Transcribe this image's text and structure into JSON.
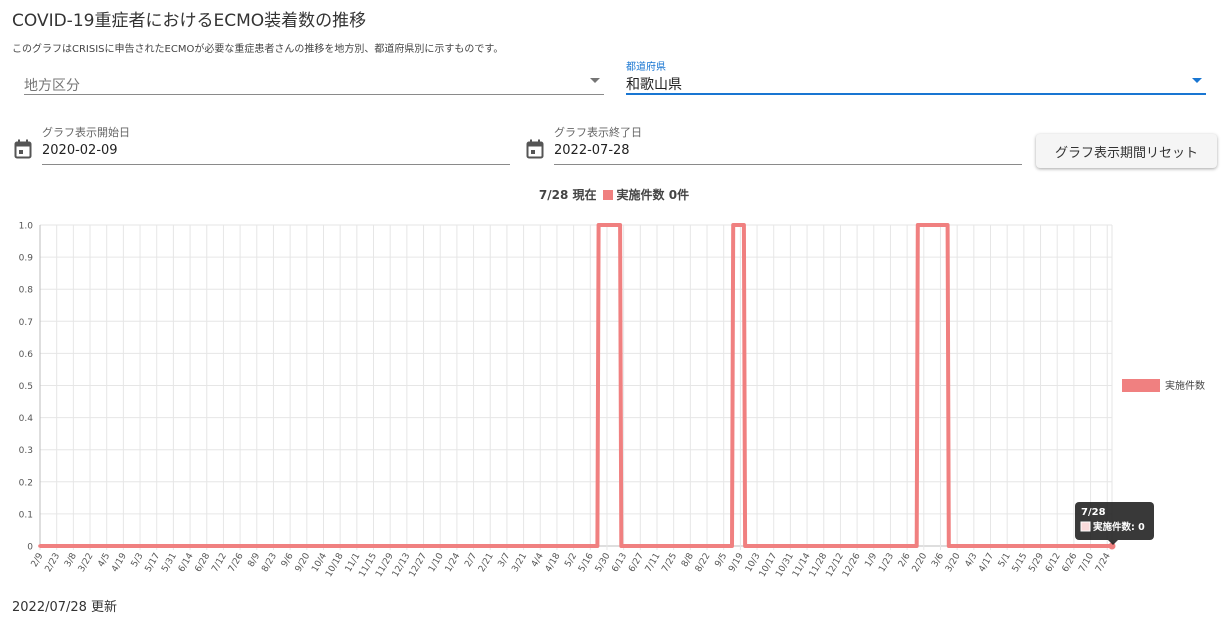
{
  "header": {
    "title": "COVID-19重症者におけるECMO装着数の推移",
    "description": "このグラフはCRISISに申告されたECMOが必要な重症患者さんの推移を地方別、都道府県別に示すものです。"
  },
  "filters": {
    "region": {
      "placeholder": "地方区分",
      "value": ""
    },
    "prefecture": {
      "label": "都道府県",
      "value": "和歌山県"
    }
  },
  "date_range": {
    "start": {
      "label": "グラフ表示開始日",
      "value": "2020-02-09"
    },
    "end": {
      "label": "グラフ表示終了日",
      "value": "2022-07-28"
    },
    "reset_label": "グラフ表示期間リセット"
  },
  "summary": {
    "date": "7/28 現在",
    "series_label": "実施件数",
    "count": "0件"
  },
  "tooltip": {
    "title": "7/28",
    "label": "実施件数: 0"
  },
  "footer": {
    "updated": "2022/07/28 更新"
  },
  "colors": {
    "series": "#f08080",
    "accent": "#1976d2"
  },
  "chart_data": {
    "type": "line",
    "title": "",
    "xlabel": "",
    "ylabel": "",
    "ylim": [
      0,
      1
    ],
    "yticks": [
      0,
      0.1,
      0.2,
      0.3,
      0.4,
      0.5,
      0.6,
      0.7,
      0.8,
      0.9,
      1.0
    ],
    "ytick_labels": [
      "0",
      "0.1",
      "0.2",
      "0.3",
      "0.4",
      "0.5",
      "0.6",
      "0.7",
      "0.8",
      "0.9",
      "1.0"
    ],
    "x_start": "2020-02-09",
    "x_end": "2022-07-28",
    "xtick_labels": [
      "2/9",
      "2/23",
      "3/8",
      "3/22",
      "4/5",
      "4/19",
      "5/3",
      "5/17",
      "5/31",
      "6/14",
      "6/28",
      "7/12",
      "7/26",
      "8/9",
      "8/23",
      "9/6",
      "9/20",
      "10/4",
      "10/18",
      "11/1",
      "11/15",
      "11/29",
      "12/13",
      "12/27",
      "1/10",
      "1/24",
      "2/7",
      "2/21",
      "3/7",
      "3/21",
      "4/4",
      "4/18",
      "5/2",
      "5/16",
      "5/30",
      "6/13",
      "6/27",
      "7/11",
      "7/25",
      "8/8",
      "8/22",
      "9/5",
      "9/19",
      "10/3",
      "10/17",
      "10/31",
      "11/14",
      "11/28",
      "12/12",
      "12/26",
      "1/9",
      "1/23",
      "2/6",
      "2/20",
      "3/6",
      "3/20",
      "4/3",
      "4/17",
      "5/1",
      "5/15",
      "5/29",
      "6/12",
      "6/26",
      "7/10",
      "7/24"
    ],
    "legend": "right",
    "grid": true,
    "series": [
      {
        "name": "実施件数",
        "values": [
          {
            "start": "2020-02-09",
            "end": "2021-05-22",
            "value": 0
          },
          {
            "start": "2021-05-23",
            "end": "2021-06-10",
            "value": 1
          },
          {
            "start": "2021-06-11",
            "end": "2021-09-12",
            "value": 0
          },
          {
            "start": "2021-09-13",
            "end": "2021-09-22",
            "value": 1
          },
          {
            "start": "2021-09-23",
            "end": "2022-02-14",
            "value": 0
          },
          {
            "start": "2022-02-15",
            "end": "2022-03-12",
            "value": 1
          },
          {
            "start": "2022-03-13",
            "end": "2022-07-28",
            "value": 0
          }
        ]
      }
    ]
  }
}
